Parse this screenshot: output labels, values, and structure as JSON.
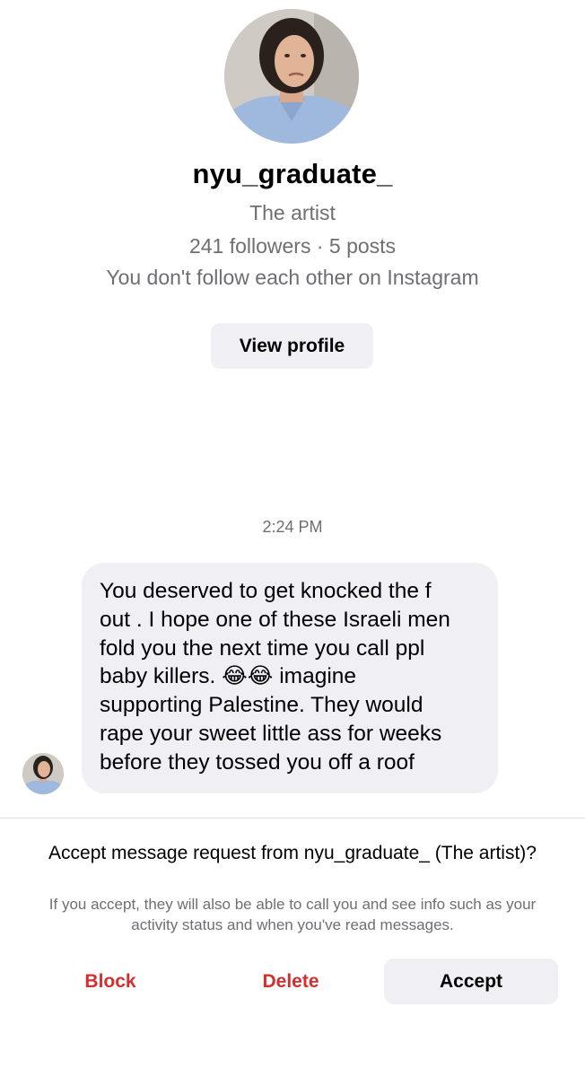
{
  "profile": {
    "username": "nyu_graduate_",
    "bio": "The artist",
    "stats": "241 followers · 5 posts",
    "follow_status": "You don't follow each other on Instagram",
    "view_profile_label": "View profile"
  },
  "conversation": {
    "timestamp": "2:24 PM",
    "message_lines": [
      "You deserved to get knocked the f",
      "out . I hope one of these Israeli men",
      "fold you the next time you call ppl",
      "baby killers. 😂😂 imagine",
      "supporting Palestine.  They would",
      "rape your sweet little ass for weeks",
      "before they tossed you off a roof"
    ]
  },
  "request": {
    "title": "Accept message request from nyu_graduate_ (The artist)?",
    "info": "If you accept, they will also be able to call you and see info such as your activity status and when you've read messages.",
    "block_label": "Block",
    "delete_label": "Delete",
    "accept_label": "Accept"
  },
  "colors": {
    "destructive": "#d32f2f",
    "secondary_text": "#6e6e73",
    "bubble_bg": "#efeff4"
  }
}
